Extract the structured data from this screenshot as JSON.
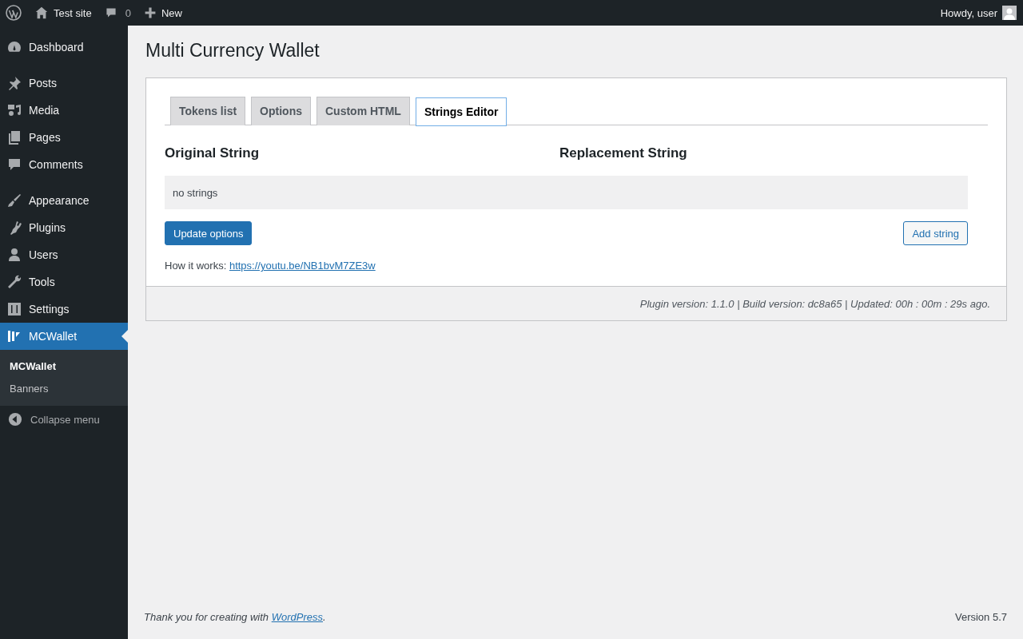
{
  "admin_bar": {
    "site_name": "Test site",
    "comments_count": "0",
    "new_label": "New",
    "greeting": "Howdy, user"
  },
  "sidebar": {
    "groups": [
      [
        {
          "label": "Dashboard",
          "selected": false
        }
      ],
      [
        {
          "label": "Posts",
          "selected": false
        },
        {
          "label": "Media",
          "selected": false
        },
        {
          "label": "Pages",
          "selected": false
        },
        {
          "label": "Comments",
          "selected": false
        }
      ],
      [
        {
          "label": "Appearance",
          "selected": false
        },
        {
          "label": "Plugins",
          "selected": false
        },
        {
          "label": "Users",
          "selected": false
        },
        {
          "label": "Tools",
          "selected": false
        },
        {
          "label": "Settings",
          "selected": false
        },
        {
          "label": "MCWallet",
          "selected": true
        }
      ]
    ],
    "submenu": [
      {
        "label": "MCWallet",
        "selected": true
      },
      {
        "label": "Banners",
        "selected": false
      }
    ],
    "collapse_label": "Collapse menu"
  },
  "page_title": "Multi Currency Wallet",
  "tabs": [
    {
      "label": "Tokens list",
      "selected": false
    },
    {
      "label": "Options",
      "selected": false
    },
    {
      "label": "Custom HTML",
      "selected": false
    },
    {
      "label": "Strings Editor",
      "selected": true
    }
  ],
  "columns": [
    "Original String",
    "Replacement String"
  ],
  "empty_message": "no strings",
  "update_button": "Update options",
  "add_button": "Add string",
  "how_it_works": {
    "label": "How it works:",
    "link": "https://youtu.be/NB1bvM7ZE3w"
  },
  "version_bar": "Plugin version: 1.1.0 | Build version: dc8a65 | Updated: 00h : 00m : 29s ago.",
  "footer": {
    "thanks": "Thank you for creating with",
    "link": "WordPress",
    "end": ".",
    "version": "Version 5.7"
  }
}
